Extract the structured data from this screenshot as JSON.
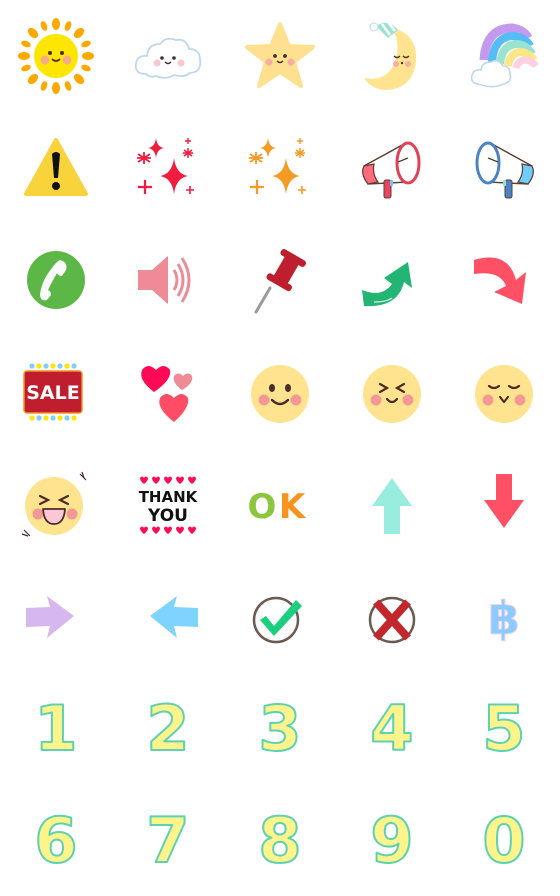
{
  "grid": {
    "columns": 5,
    "rows": 8,
    "items": [
      {
        "name": "sun",
        "icon": "sun-icon"
      },
      {
        "name": "cloud",
        "icon": "cloud-icon"
      },
      {
        "name": "star",
        "icon": "star-icon"
      },
      {
        "name": "sleepy-moon",
        "icon": "moon-icon"
      },
      {
        "name": "rainbow",
        "icon": "rainbow-icon"
      },
      {
        "name": "warning",
        "icon": "warning-icon"
      },
      {
        "name": "red-sparkles",
        "icon": "sparkles-icon"
      },
      {
        "name": "orange-sparkles",
        "icon": "sparkles-icon"
      },
      {
        "name": "red-megaphone",
        "icon": "megaphone-icon"
      },
      {
        "name": "blue-megaphone",
        "icon": "megaphone-icon"
      },
      {
        "name": "phone",
        "icon": "phone-icon"
      },
      {
        "name": "speaker",
        "icon": "speaker-icon"
      },
      {
        "name": "pushpin",
        "icon": "pushpin-icon"
      },
      {
        "name": "green-curved-arrow",
        "icon": "curved-arrow-up-icon"
      },
      {
        "name": "red-curved-arrow",
        "icon": "curved-arrow-down-icon"
      },
      {
        "name": "sale-sign",
        "icon": "sale-icon",
        "text": "SALE"
      },
      {
        "name": "hearts",
        "icon": "hearts-icon"
      },
      {
        "name": "smile-face",
        "icon": "smile-face-icon"
      },
      {
        "name": "squint-face",
        "icon": "squint-face-icon"
      },
      {
        "name": "content-face",
        "icon": "content-face-icon"
      },
      {
        "name": "laughing-face",
        "icon": "laughing-face-icon"
      },
      {
        "name": "thank-you",
        "icon": "thank-you-icon",
        "text_line1": "THANK",
        "text_line2": "YOU"
      },
      {
        "name": "ok",
        "icon": "ok-icon",
        "text_o": "O",
        "text_k": "K"
      },
      {
        "name": "up-arrow",
        "icon": "arrow-up-icon"
      },
      {
        "name": "down-arrow",
        "icon": "arrow-down-icon"
      },
      {
        "name": "right-arrow",
        "icon": "arrow-right-icon"
      },
      {
        "name": "left-arrow",
        "icon": "arrow-left-icon"
      },
      {
        "name": "check",
        "icon": "check-circle-icon"
      },
      {
        "name": "cross",
        "icon": "cross-circle-icon"
      },
      {
        "name": "baht",
        "icon": "baht-icon",
        "text": "฿"
      },
      {
        "name": "digit-1",
        "icon": "digit-icon",
        "text": "1"
      },
      {
        "name": "digit-2",
        "icon": "digit-icon",
        "text": "2"
      },
      {
        "name": "digit-3",
        "icon": "digit-icon",
        "text": "3"
      },
      {
        "name": "digit-4",
        "icon": "digit-icon",
        "text": "4"
      },
      {
        "name": "digit-5",
        "icon": "digit-icon",
        "text": "5"
      },
      {
        "name": "digit-6",
        "icon": "digit-icon",
        "text": "6"
      },
      {
        "name": "digit-7",
        "icon": "digit-icon",
        "text": "7"
      },
      {
        "name": "digit-8",
        "icon": "digit-icon",
        "text": "8"
      },
      {
        "name": "digit-9",
        "icon": "digit-icon",
        "text": "9"
      },
      {
        "name": "digit-0",
        "icon": "digit-icon",
        "text": "0"
      }
    ]
  },
  "colors": {
    "sun": "#FFE600",
    "sun_rays": "#FFA800",
    "face_yellow": "#FFE38E",
    "blush": "#F3A0A8",
    "warning": "#F8D33B",
    "sparkle_red": "#F21C3E",
    "sparkle_orange": "#F59A23",
    "phone_green": "#5DB746",
    "speaker_pink": "#EE8B96",
    "pin_red": "#BE1E2D",
    "arrow_green": "#22B573",
    "arrow_red": "#FF5066",
    "sale_red": "#BE1E2D",
    "heart_pink": "#FF0A54",
    "ok_green": "#8CC63F",
    "ok_orange": "#F7931E",
    "arrow_mint": "#99EDDF",
    "arrow_lilac": "#D6B8EE",
    "arrow_sky": "#7FD4FF",
    "check_green": "#1BCF7E",
    "cross_red": "#C1272D",
    "baht_blue": "#8CCBFF",
    "digit_fill": "#FFF38C",
    "digit_stroke": "#5DD2B0"
  }
}
